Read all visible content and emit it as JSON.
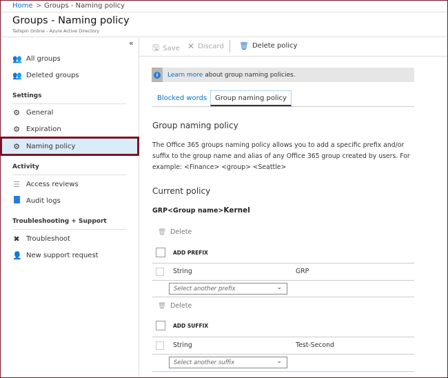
{
  "breadcrumb": {
    "home": "Home",
    "separator": ">",
    "current": "Groups - Naming policy"
  },
  "header": {
    "title": "Groups - Naming policy",
    "subtitle": "Tailspin Online - Azure Active Directory"
  },
  "sidebar": {
    "collapse_label": "«",
    "top_items": [
      {
        "label": "All groups",
        "icon": "groups-icon"
      },
      {
        "label": "Deleted groups",
        "icon": "groups-icon"
      }
    ],
    "sections": [
      {
        "title": "Settings",
        "items": [
          {
            "label": "General",
            "icon": "gear-icon"
          },
          {
            "label": "Expiration",
            "icon": "gear-icon"
          },
          {
            "label": "Naming policy",
            "icon": "gear-icon",
            "selected": true
          }
        ]
      },
      {
        "title": "Activity",
        "items": [
          {
            "label": "Access reviews",
            "icon": "list-icon"
          },
          {
            "label": "Audit logs",
            "icon": "book-icon"
          }
        ]
      },
      {
        "title": "Troubleshooting + Support",
        "items": [
          {
            "label": "Troubleshoot",
            "icon": "tools-icon"
          },
          {
            "label": "New support request",
            "icon": "support-icon"
          }
        ]
      }
    ]
  },
  "toolbar": {
    "save": "Save",
    "discard": "Discard",
    "delete_policy": "Delete policy"
  },
  "info": {
    "link": "Learn more",
    "text": " about group naming policies."
  },
  "tabs": [
    {
      "label": "Blocked words",
      "active": false
    },
    {
      "label": "Group naming policy",
      "active": true
    }
  ],
  "main": {
    "heading": "Group naming policy",
    "description": "The Office 365 groups naming policy allows you to add a specific prefix and/or suffix to the group name and alias of any Office 365 group created by users. For example: <Finance> <group> <Seattle>",
    "current_policy_heading": "Current policy",
    "policy_prefix": "GRP<Group name>",
    "policy_suffix": "Kernel",
    "prefix": {
      "delete": "Delete",
      "add_label": "ADD PREFIX",
      "row_type": "String",
      "row_value": "GRP",
      "select_placeholder": "Select another prefix"
    },
    "suffix": {
      "delete": "Delete",
      "add_label": "ADD SUFFIX",
      "row_type": "String",
      "row_value": "Test-Second",
      "select_placeholder": "Select another suffix"
    }
  },
  "colors": {
    "accent": "#0072c6",
    "highlight_border": "#7a1426",
    "selected_bg": "#dbecf9"
  }
}
